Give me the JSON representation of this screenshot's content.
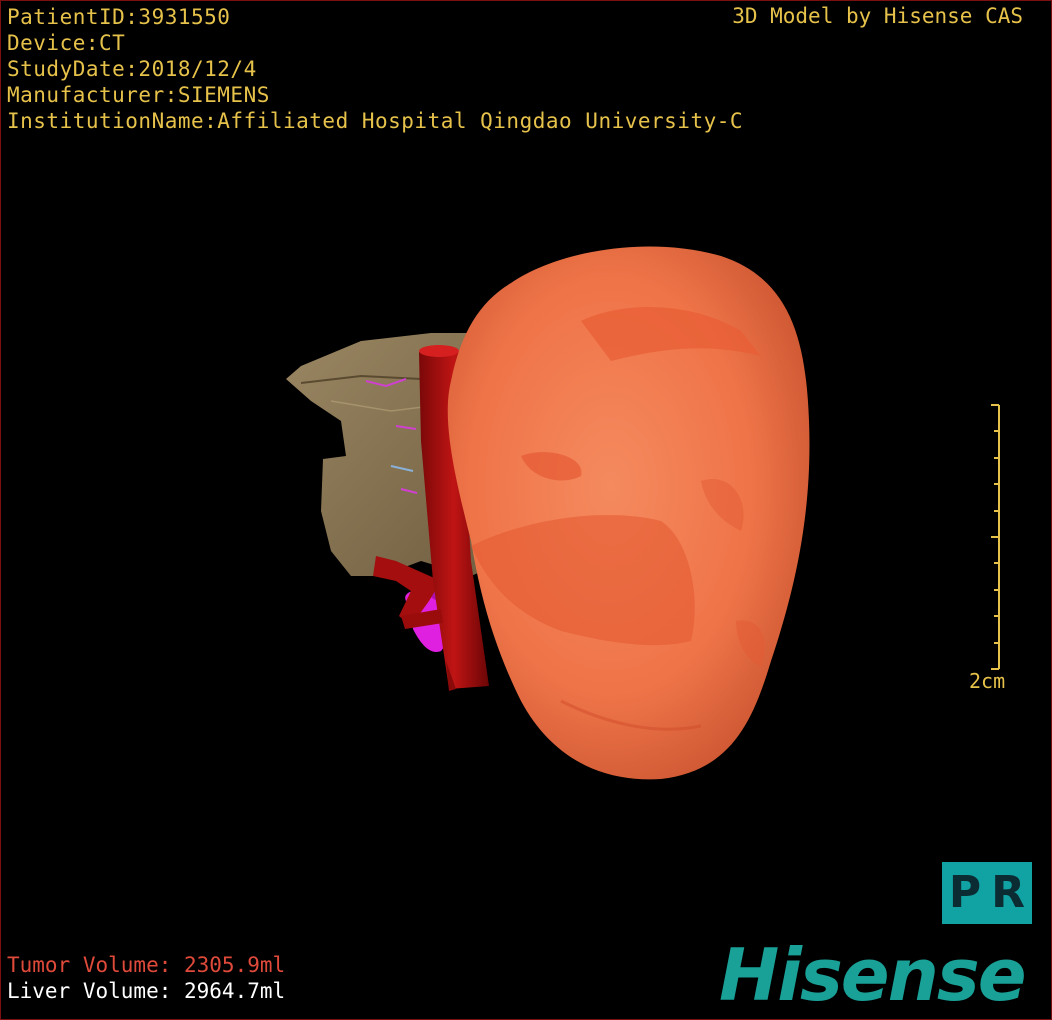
{
  "patient": {
    "patient_id": "PatientID:3931550",
    "device": "Device:CT",
    "study_date": "StudyDate:2018/12/4",
    "manufacturer": "Manufacturer:SIEMENS",
    "institution": "InstitutionName:Affiliated Hospital Qingdao University-C"
  },
  "credit": "3D Model by Hisense CAS",
  "scale_bar": {
    "label": "2cm",
    "length_cm": 2
  },
  "volumes": {
    "tumor": "Tumor Volume: 2305.9ml",
    "liver": "Liver Volume: 2964.7ml"
  },
  "badge": {
    "p": "P",
    "r": "R"
  },
  "brand": "Hisense",
  "colors": {
    "overlay_text": "#e6c24a",
    "tumor_text": "#e04a3a",
    "liver_text": "#ffffff",
    "tumor": "#f0744a",
    "liver": "#8e7a57",
    "vessel": "#b01010",
    "kidney": "#e020e0",
    "brand": "#19a097",
    "badge": "#11a3a3"
  },
  "icons": [
    "tumor-model",
    "liver-model",
    "aorta-vessel",
    "kidney-model"
  ]
}
